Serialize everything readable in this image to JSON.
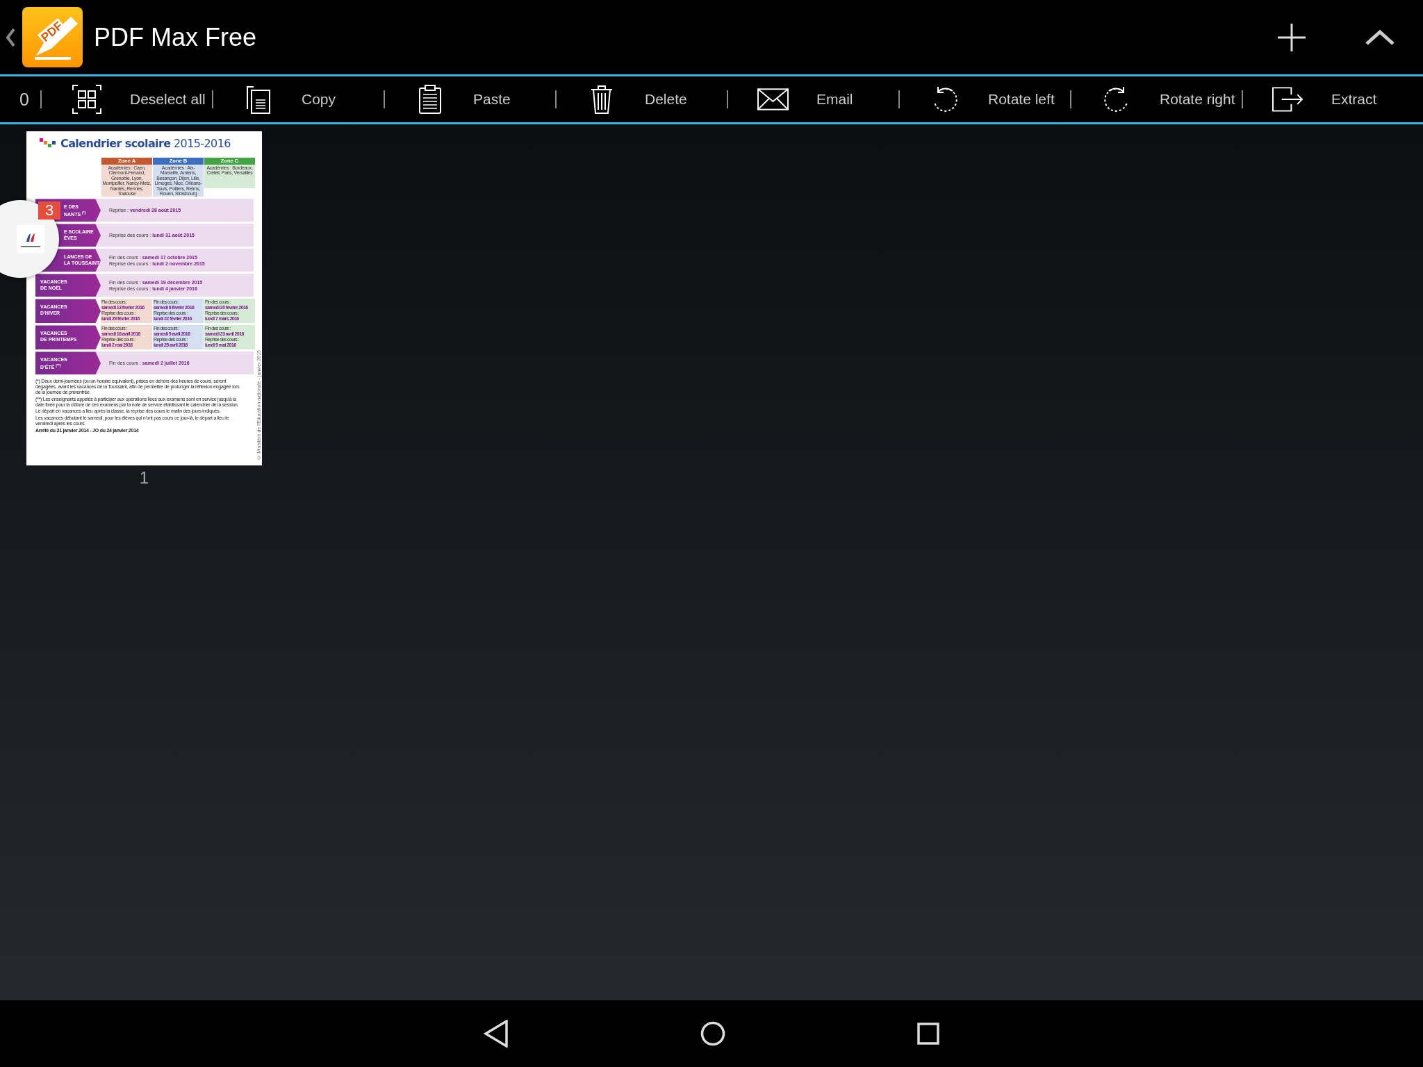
{
  "header": {
    "logo_text": "PDF",
    "title": "PDF Max Free"
  },
  "toolbar": {
    "count": "0",
    "actions": [
      "Deselect all",
      "Copy",
      "Paste",
      "Delete",
      "Email",
      "Rotate left",
      "Rotate right",
      "Extract"
    ]
  },
  "document": {
    "title": "**Calendrier scolaire** 2015-2016",
    "zones": [
      {
        "name": "Zone A",
        "color": "#c4582e",
        "academies": "Académies : Caen, Clermont-Ferrand, Grenoble, Lyon, Montpellier, Nancy-Metz, Nantes, Rennes, Toulouse"
      },
      {
        "name": "Zone B",
        "color": "#3d6fc0",
        "academies": "Académies : Aix-Marseille, Amiens, Besançon, Dijon, Lille, Limoges, Nice, Orléans-Tours, Poitiers, Reims, Rouen, Strasbourg"
      },
      {
        "name": "Zone C",
        "color": "#44a444",
        "academies": "Académies : Bordeaux, Créteil, Paris, Versailles"
      }
    ],
    "rows": [
      {
        "kind": "single",
        "covered": true,
        "label": [
          "E DES",
          "NANTS $^{(*)}$"
        ],
        "lines": [
          "Reprise : **vendredi 28 août  2015**"
        ]
      },
      {
        "kind": "single",
        "covered": true,
        "label": [
          "E SCOLAIRE",
          "ÈVES"
        ],
        "lines": [
          "Reprise des cours : **lundi 31 août 2015**"
        ]
      },
      {
        "kind": "single",
        "covered": true,
        "label": [
          "LANCES DE",
          "LA TOUSSAINT"
        ],
        "lines": [
          "Fin des cours : **samedi 17 octobre 2015**",
          "Reprise des cours : **lundi 2 novembre 2015**"
        ]
      },
      {
        "kind": "single",
        "covered": false,
        "label": [
          "VACANCES",
          "DE NOËL"
        ],
        "lines": [
          "Fin des cours : **samedi 19 décembre 2015**",
          "Reprise des cours : **lundi 4 janvier 2016**"
        ]
      },
      {
        "kind": "zones",
        "covered": false,
        "label": [
          "VACANCES",
          "D'HIVER"
        ],
        "zones": [
          [
            "Fin des cours :",
            "**samedi 13 février 2016**",
            "Reprise des cours :",
            "**lundi 29 février 2016**"
          ],
          [
            "Fin des cours :",
            "**samedi 6 février 2016**",
            "Reprise des cours :",
            "**lundi 22 février 2016**"
          ],
          [
            "Fin des cours :",
            "**samedi 20 février 2016**",
            "Reprise des cours :",
            "**lundi 7 mars 2016**"
          ]
        ]
      },
      {
        "kind": "zones",
        "covered": false,
        "label": [
          "VACANCES",
          "DE PRINTEMPS"
        ],
        "zones": [
          [
            "Fin des cours :",
            "**samedi 16 avril 2016**",
            "Reprise des cours :",
            "**lundi 2 mai 2016**"
          ],
          [
            "Fin des cours :",
            "**samedi 9 avril 2016**",
            "Reprise des cours :",
            "**lundi 25 avril 2016**"
          ],
          [
            "Fin des cours :",
            "**samedi 23 avril 2016**",
            "Reprise des cours :",
            "**lundi 9 mai 2016**"
          ]
        ]
      },
      {
        "kind": "single",
        "covered": false,
        "label": [
          "VACANCES",
          "D'ÉTÉ $^{(**)}$"
        ],
        "lines": [
          "Fin des cours : **samedi 2 juillet 2016**"
        ]
      }
    ],
    "notes": [
      "(*) Deux demi-journées (ou un horaire équivalent), prises en dehors des heures de cours, seront dégagées, avant les vacances de la Toussaint, afin de permettre de prolonger la réflexion engagée lors de la journée de prérentrée.",
      "(**) Les enseignants appelés à participer aux opérations liées aux examens sont en service jusqu'à la date fixée pour la clôture de ces examens par la note de service établissant le calendrier de la session.",
      "Le départ en vacances a lieu après la classe, la reprise des cours le matin des jours indiqués.",
      "Les vacances débutant le samedi, pour les élèves qui n'ont pas cours ce jour-là, le départ a lieu le vendredi après les cours.",
      "**Arrêté du 21 janvier 2014 - JO du 24 janvier 2014**"
    ],
    "side_note": "© Ministère de l'Éducation nationale - janvier 2015",
    "page_number": "1"
  },
  "bubble": {
    "badge": "3"
  }
}
